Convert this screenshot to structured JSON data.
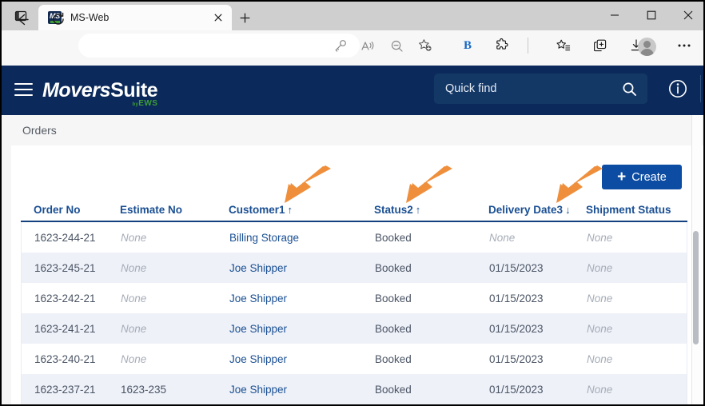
{
  "browser": {
    "tab": {
      "title": "MS-Web",
      "favicon_text": "MS"
    },
    "tab_strip_icon": "tab-actions-icon",
    "new_tab_label": "+",
    "window_controls": {
      "minimize": "—",
      "maximize": "□",
      "close": "✕"
    },
    "address_bar": {
      "value": "",
      "placeholder": ""
    },
    "toolbar_icons": [
      "back-icon",
      "reload-icon",
      "key-icon",
      "read-aloud-icon",
      "zoom-out-icon",
      "favorite-add-icon",
      "bold-b-icon",
      "extensions-icon",
      "collections-icon",
      "split-screen-icon",
      "downloads-icon",
      "profile-avatar",
      "more-icon"
    ],
    "bold_badge_label": "B"
  },
  "app": {
    "menu_icon": "hamburger-menu-icon",
    "logo": {
      "part1": "Movers",
      "part2": "Suite",
      "byline_prefix": "by",
      "byline": "EWS"
    },
    "search": {
      "value": "Quick find",
      "placeholder": "Quick find",
      "icon": "search-icon"
    },
    "info_icon": "info-circle-icon"
  },
  "page": {
    "tab_label": "Orders",
    "create_button": {
      "label": "Create",
      "plus": "+"
    }
  },
  "table": {
    "columns": [
      {
        "label": "Order No",
        "sort": ""
      },
      {
        "label": "Estimate No",
        "sort": ""
      },
      {
        "label": "Customer1",
        "sort": "↑"
      },
      {
        "label": "Status2",
        "sort": "↑"
      },
      {
        "label": "Delivery Date3",
        "sort": "↓"
      },
      {
        "label": "Shipment Status",
        "sort": ""
      }
    ],
    "rows": [
      {
        "order_no": "1623-244-21",
        "estimate_no": "None",
        "customer": "Billing Storage",
        "status": "Booked",
        "delivery_date": "None",
        "shipment_status": "None"
      },
      {
        "order_no": "1623-245-21",
        "estimate_no": "None",
        "customer": "Joe Shipper",
        "status": "Booked",
        "delivery_date": "01/15/2023",
        "shipment_status": "None"
      },
      {
        "order_no": "1623-242-21",
        "estimate_no": "None",
        "customer": "Joe Shipper",
        "status": "Booked",
        "delivery_date": "01/15/2023",
        "shipment_status": "None"
      },
      {
        "order_no": "1623-241-21",
        "estimate_no": "None",
        "customer": "Joe Shipper",
        "status": "Booked",
        "delivery_date": "01/15/2023",
        "shipment_status": "None"
      },
      {
        "order_no": "1623-240-21",
        "estimate_no": "None",
        "customer": "Joe Shipper",
        "status": "Booked",
        "delivery_date": "01/15/2023",
        "shipment_status": "None"
      },
      {
        "order_no": "1623-237-21",
        "estimate_no": "1623-235",
        "customer": "Joe Shipper",
        "status": "Booked",
        "delivery_date": "01/15/2023",
        "shipment_status": "None"
      }
    ]
  },
  "annotations": {
    "arrows": [
      {
        "name": "arrow-to-customer-column",
        "color": "#ef8f3c"
      },
      {
        "name": "arrow-to-status-column",
        "color": "#ef8f3c"
      },
      {
        "name": "arrow-to-delivery-date-column",
        "color": "#ef8f3c"
      }
    ]
  },
  "colors": {
    "app_header": "#0b2a5b",
    "accent_blue": "#0c4ca3",
    "link_blue": "#1a4f93",
    "header_underline": "#14407f",
    "row_alt": "#eef1f8",
    "annotation_orange": "#ef8f3c",
    "logo_green": "#3f9c35"
  }
}
